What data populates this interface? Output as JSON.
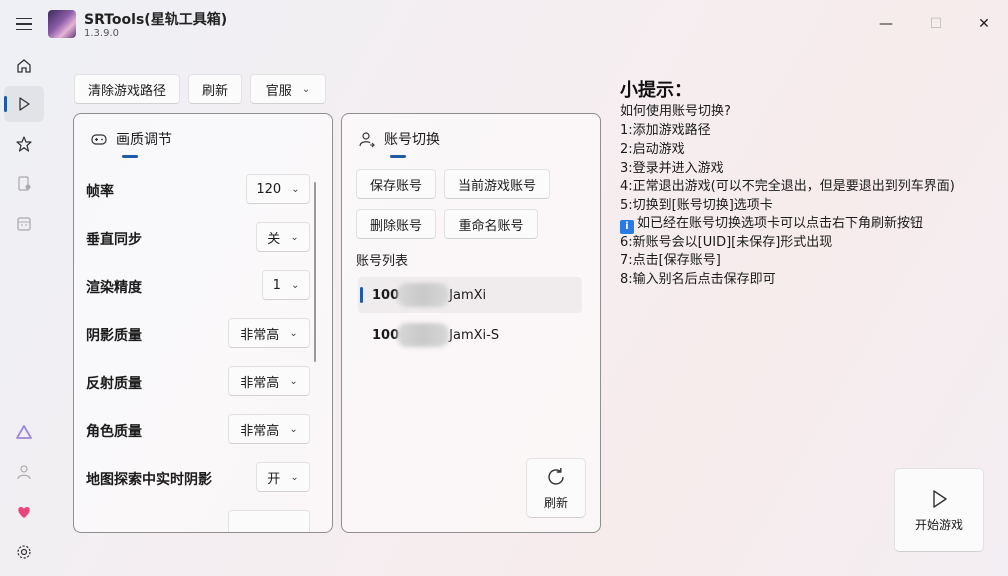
{
  "app": {
    "title": "SRTools(星轨工具箱)",
    "version": "1.3.9.0"
  },
  "window": {
    "minimize": "—",
    "maximize": "☐",
    "close": "✕"
  },
  "toolbar": {
    "clear_path": "清除游戏路径",
    "refresh": "刷新",
    "server": "官服"
  },
  "graphics": {
    "title": "画质调节",
    "settings": [
      {
        "label": "帧率",
        "value": "120"
      },
      {
        "label": "垂直同步",
        "value": "关"
      },
      {
        "label": "渲染精度",
        "value": "1"
      },
      {
        "label": "阴影质量",
        "value": "非常高"
      },
      {
        "label": "反射质量",
        "value": "非常高"
      },
      {
        "label": "角色质量",
        "value": "非常高"
      },
      {
        "label": "地图探索中实时阴影",
        "value": "开"
      }
    ]
  },
  "account": {
    "title": "账号切换",
    "save": "保存账号",
    "current": "当前游戏账号",
    "delete": "删除账号",
    "rename": "重命名账号",
    "list_label": "账号列表",
    "items": [
      {
        "id": "100",
        "name": "JamXi"
      },
      {
        "id": "100",
        "name": "JamXi-S"
      }
    ],
    "refresh": "刷新"
  },
  "tips": {
    "title": "小提示：",
    "lines": [
      "如何使用账号切换?",
      "1:添加游戏路径",
      "2:启动游戏",
      "3:登录并进入游戏",
      "4:正常退出游戏(可以不完全退出，但是要退出到列车界面)",
      "5:切换到[账号切换]选项卡",
      "如已经在账号切换选项卡可以点击右下角刷新按钮",
      "6:新账号会以[UID][未保存]形式出现",
      "7:点击[保存账号]",
      "8:输入别名后点击保存即可"
    ]
  },
  "launch": {
    "label": "开始游戏"
  },
  "colors": {
    "accent": "#1e5aa8",
    "info": "#2a7be4"
  }
}
